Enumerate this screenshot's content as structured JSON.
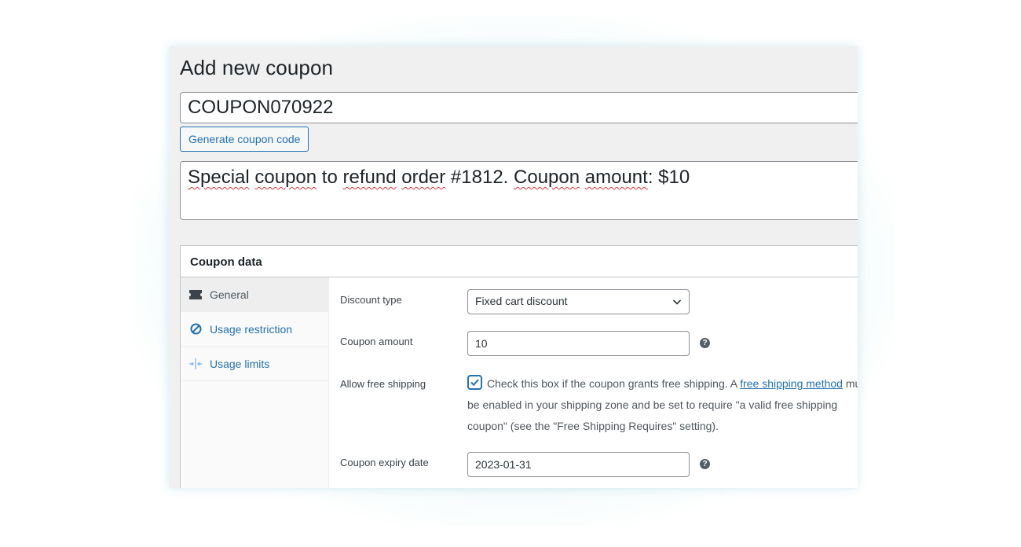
{
  "page": {
    "title": "Add new coupon"
  },
  "coupon_code": {
    "value": "COUPON070922"
  },
  "generate_button": {
    "label": "Generate coupon code"
  },
  "description": {
    "words": [
      "Special",
      " ",
      "coupon",
      " to ",
      "refund",
      " ",
      "order",
      " #1812. ",
      "Coupon",
      " ",
      "amount",
      ": $10"
    ]
  },
  "coupon_data": {
    "header": "Coupon data",
    "tabs": [
      {
        "label": "General",
        "icon": "ticket-icon",
        "active": true
      },
      {
        "label": "Usage restriction",
        "icon": "prohibited-icon",
        "active": false
      },
      {
        "label": "Usage limits",
        "icon": "limits-icon",
        "active": false
      }
    ],
    "general": {
      "discount_type": {
        "label": "Discount type",
        "value": "Fixed cart discount"
      },
      "coupon_amount": {
        "label": "Coupon amount",
        "value": "10"
      },
      "free_shipping": {
        "label": "Allow free shipping",
        "checked": true,
        "text_before": "Check this box if the coupon grants free shipping. A ",
        "link_text": "free shipping method",
        "text_after": " must be enabled in your shipping zone and be set to require \"a valid free shipping coupon\" (see the \"Free Shipping Requires\" setting)."
      },
      "expiry_date": {
        "label": "Coupon expiry date",
        "value": "2023-01-31"
      },
      "help_icon_glyph": "?"
    }
  },
  "colors": {
    "accent": "#2271b1",
    "page_bg": "#f0f0f1",
    "spellcheck": "#d63638"
  }
}
